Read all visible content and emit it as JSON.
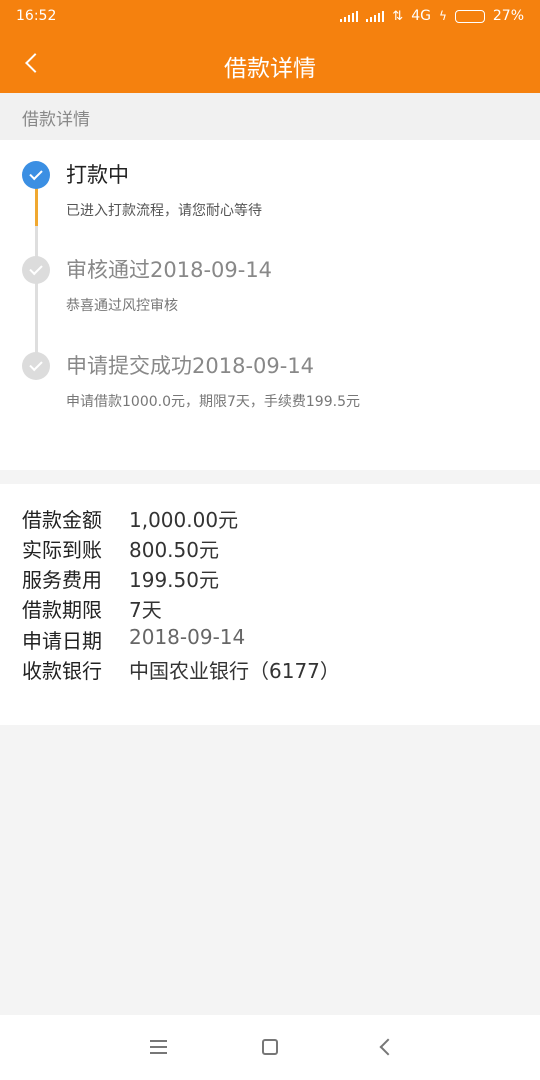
{
  "status_bar": {
    "time": "16:52",
    "network": "4G",
    "battery": "27%",
    "battery_level": 0.27
  },
  "nav": {
    "title": "借款详情"
  },
  "section_header": "借款详情",
  "timeline": [
    {
      "title": "打款中",
      "desc": "已进入打款流程，请您耐心等待",
      "state": "active"
    },
    {
      "title": "审核通过2018-09-14",
      "desc": "恭喜通过风控审核",
      "state": "done"
    },
    {
      "title": "申请提交成功2018-09-14",
      "desc": "申请借款1000.0元，期限7天，手续费199.5元",
      "state": "done"
    }
  ],
  "details": [
    {
      "label": "借款金额",
      "value": "1,000.00元"
    },
    {
      "label": "实际到账",
      "value": "800.50元"
    },
    {
      "label": "服务费用",
      "value": "199.50元"
    },
    {
      "label": "借款期限",
      "value": "7天"
    },
    {
      "label": "申请日期",
      "value": "2018-09-14"
    },
    {
      "label": "收款银行",
      "value": "中国农业银行（6177）"
    }
  ],
  "colors": {
    "accent": "#f5810e",
    "active_step": "#3b8fe3",
    "progress_line": "#f0a830",
    "inactive_step": "#dcdcdc"
  }
}
